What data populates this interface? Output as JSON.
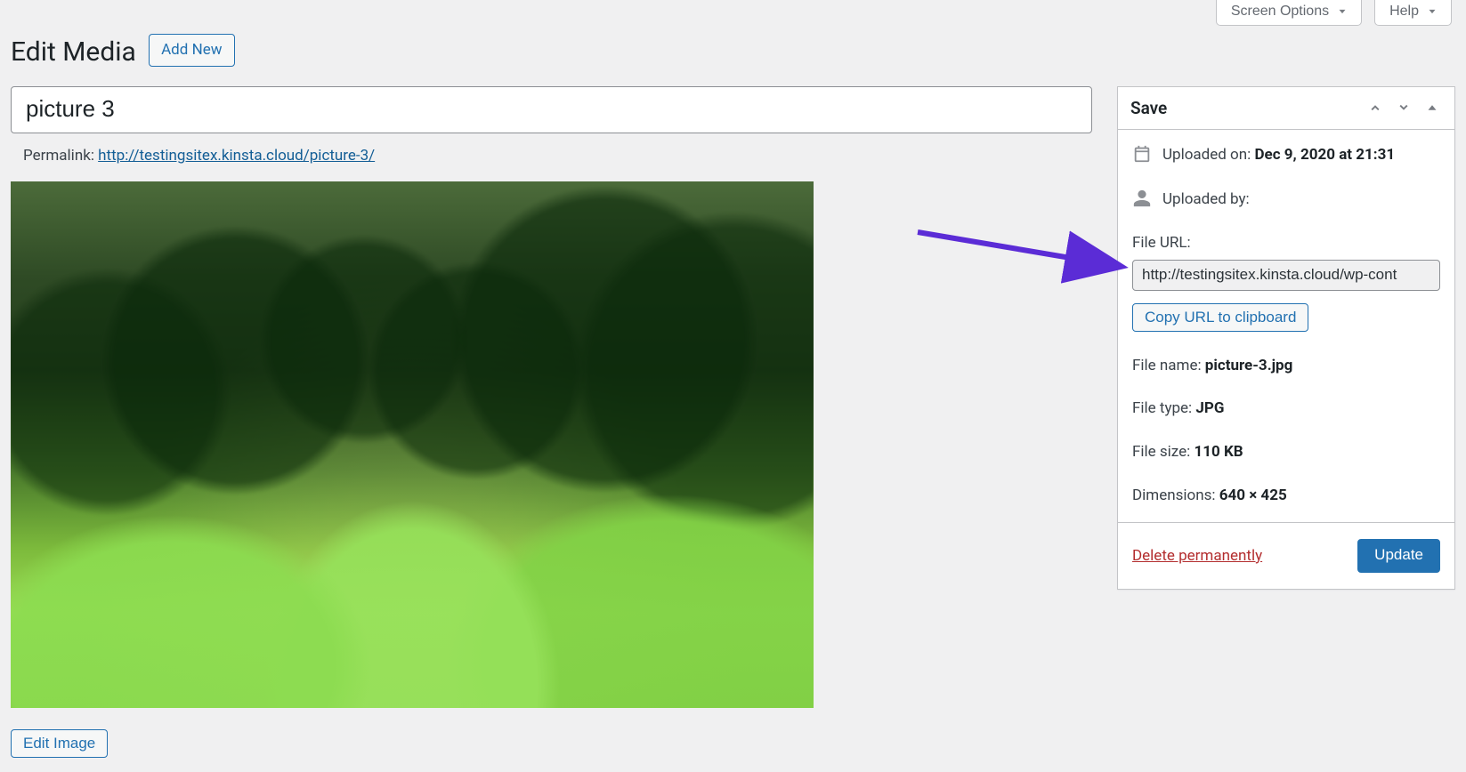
{
  "screen_meta": {
    "screen_options": "Screen Options",
    "help": "Help"
  },
  "page": {
    "title": "Edit Media",
    "add_new": "Add New"
  },
  "media": {
    "title_value": "picture 3",
    "permalink_label": "Permalink:",
    "permalink_url": "http://testingsitex.kinsta.cloud/picture-3/",
    "edit_image": "Edit Image"
  },
  "save_box": {
    "heading": "Save",
    "uploaded_on_label": "Uploaded on: ",
    "uploaded_on_value": "Dec 9, 2020 at 21:31",
    "uploaded_by_label": "Uploaded by:",
    "file_url_label": "File URL:",
    "file_url_value": "http://testingsitex.kinsta.cloud/wp-cont",
    "copy_url": "Copy URL to clipboard",
    "file_name_label": "File name: ",
    "file_name_value": "picture-3.jpg",
    "file_type_label": "File type: ",
    "file_type_value": "JPG",
    "file_size_label": "File size: ",
    "file_size_value": "110 KB",
    "dimensions_label": "Dimensions: ",
    "dimensions_value": "640 × 425",
    "delete": "Delete permanently",
    "update": "Update"
  }
}
